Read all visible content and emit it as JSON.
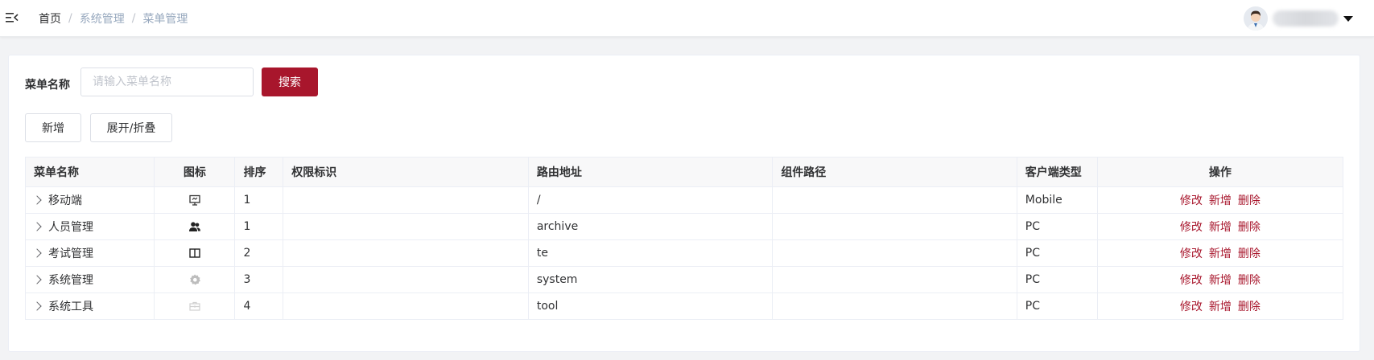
{
  "header": {
    "breadcrumb": [
      "首页",
      "系统管理",
      "菜单管理"
    ],
    "icons": {
      "hamburger": "hamburger-icon",
      "avatar": "user-avatar",
      "dropdown": "caret-down-icon"
    }
  },
  "search": {
    "label": "菜单名称",
    "placeholder": "请输入菜单名称",
    "value": "",
    "button": "搜索"
  },
  "toolbar": {
    "add": "新增",
    "toggle": "展开/折叠"
  },
  "table": {
    "columns": [
      "菜单名称",
      "图标",
      "排序",
      "权限标识",
      "路由地址",
      "组件路径",
      "客户端类型",
      "操作"
    ],
    "rows": [
      {
        "name": "移动端",
        "icon": "monitor-icon",
        "order": "1",
        "perms": "",
        "path": "/",
        "component": "",
        "client": "Mobile"
      },
      {
        "name": "人员管理",
        "icon": "users-icon",
        "order": "1",
        "perms": "",
        "path": "archive",
        "component": "",
        "client": "PC"
      },
      {
        "name": "考试管理",
        "icon": "book-icon",
        "order": "2",
        "perms": "",
        "path": "te",
        "component": "",
        "client": "PC"
      },
      {
        "name": "系统管理",
        "icon": "gear-icon",
        "order": "3",
        "perms": "",
        "path": "system",
        "component": "",
        "client": "PC"
      },
      {
        "name": "系统工具",
        "icon": "toolbox-icon",
        "order": "4",
        "perms": "",
        "path": "tool",
        "component": "",
        "client": "PC"
      }
    ],
    "actions": [
      "修改",
      "新增",
      "删除"
    ]
  },
  "colors": {
    "primary": "#a8162c",
    "breadcrumb_inactive": "#97a8be",
    "header_bg": "#f8f8f9",
    "page_bg": "#f2f3f5"
  }
}
